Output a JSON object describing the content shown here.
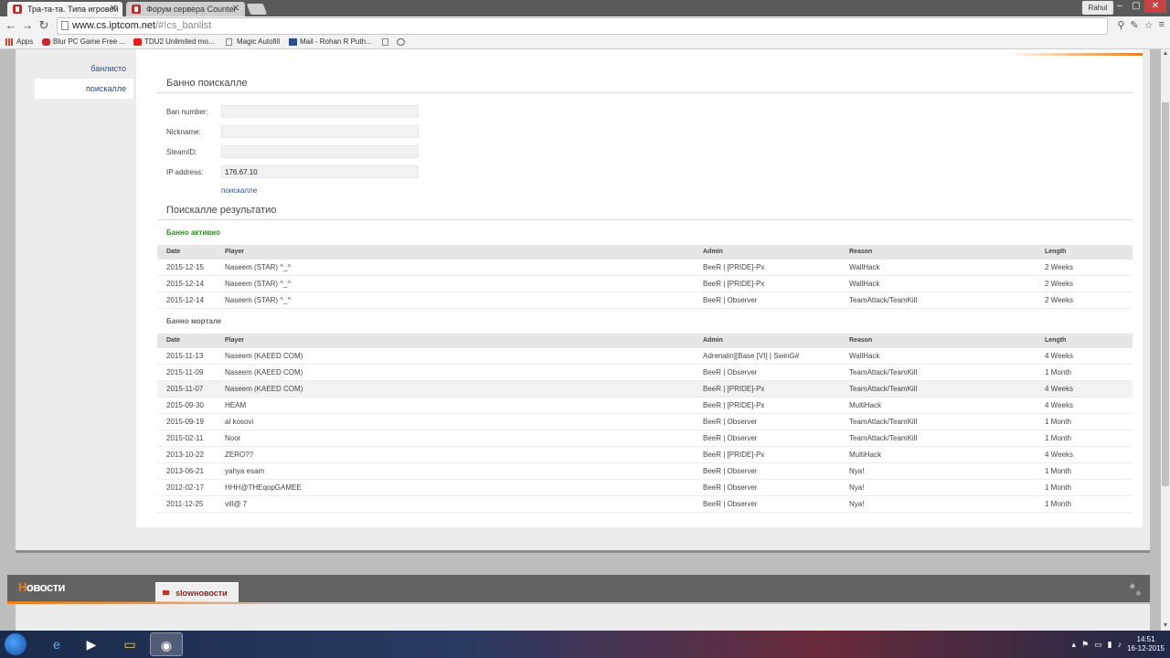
{
  "browser": {
    "tabs": [
      {
        "title": "Тра-та-та. Типа игровой",
        "active": true
      },
      {
        "title": "Форум сервера Counter-",
        "active": false
      }
    ],
    "user": "Rahul",
    "url_host": "www.cs.iptcom.net",
    "url_path": "/#!cs_banlist",
    "bookmarks": [
      {
        "label": "Apps",
        "icon": "apps-grid-icon"
      },
      {
        "label": "Blur PC Game Free ...",
        "icon": "gamepad-icon"
      },
      {
        "label": "TDU2 Unlimited mo...",
        "icon": "youtube-icon"
      },
      {
        "label": "Magic Autofill",
        "icon": "page-icon"
      },
      {
        "label": "Mail - Rohan R Puth...",
        "icon": "mail-icon"
      }
    ]
  },
  "sidebar": {
    "items": [
      {
        "label": "банлисто",
        "active": false
      },
      {
        "label": "поискалле",
        "active": true
      }
    ]
  },
  "search": {
    "title": "Банно поискалле",
    "fields": [
      {
        "label": "Ban number:",
        "value": ""
      },
      {
        "label": "Nickname:",
        "value": ""
      },
      {
        "label": "SteamID:",
        "value": ""
      },
      {
        "label": "IP address:",
        "value": "176.67.10"
      }
    ],
    "submit_label": "поискалле"
  },
  "results": {
    "title": "Поискалле результатио",
    "columns": [
      "Date",
      "Player",
      "Admin",
      "Reason",
      "Length"
    ],
    "active_title": "Банно активио",
    "active_rows": [
      [
        "2015-12-15",
        "Naseem (STAR) ^_^",
        "BeeR | [PRIDE]-Px",
        "WallHack",
        "2 Weeks"
      ],
      [
        "2015-12-14",
        "Naseem (STAR) ^_^",
        "BeeR | [PRIDE]-Px",
        "WallHack",
        "2 Weeks"
      ],
      [
        "2015-12-14",
        "Naseem (STAR) ^_^",
        "BeeR | Observer",
        "TeamAttack/TeamKill",
        "2 Weeks"
      ]
    ],
    "expired_title": "Банно мортале",
    "expired_rows": [
      [
        "2015-11-13",
        "Naseem (KAEED COM)",
        "Adrenalin][Base [VI] | SwinG#",
        "WallHack",
        "4 Weeks"
      ],
      [
        "2015-11-09",
        "Naseem (KAEED COM)",
        "BeeR | Observer",
        "TeamAttack/TeamKill",
        "1 Month"
      ],
      [
        "2015-11-07",
        "Naseem (KAEED COM)",
        "BeeR | [PRIDE]-Px",
        "TeamAttack/TeamKill",
        "4 Weeks"
      ],
      [
        "2015-09-30",
        "HEAM",
        "BeeR | [PRIDE]-Px",
        "MultiHack",
        "4 Weeks"
      ],
      [
        "2015-09-19",
        "al kosovi",
        "BeeR | Observer",
        "TeamAttack/TeamKill",
        "1 Month"
      ],
      [
        "2015-02-11",
        "Noor",
        "BeeR | Observer",
        "TeamAttack/TeamKill",
        "1 Month"
      ],
      [
        "2013-10-22",
        "ZERO??",
        "BeeR | [PRIDE]-Px",
        "MultiHack",
        "4 Weeks"
      ],
      [
        "2013-06-21",
        "yahya esam",
        "BeeR | Observer",
        "Nya!",
        "1 Month"
      ],
      [
        "2012-02-17",
        "HHH@THEqopGAMEE",
        "BeeR | Observer",
        "Nya!",
        "1 Month"
      ],
      [
        "2011-12-25",
        "vill@ 7",
        "BeeR | Observer",
        "Nya!",
        "1 Month"
      ]
    ]
  },
  "news": {
    "title_first": "Н",
    "title_rest": "овости",
    "tab_label": "slowновости"
  },
  "taskbar": {
    "time": "14:51",
    "date": "16-12-2015"
  },
  "colors": {
    "accent_orange": "#ef7f1a",
    "active_green": "#2e8b1e",
    "link_blue": "#2d4e9a"
  }
}
